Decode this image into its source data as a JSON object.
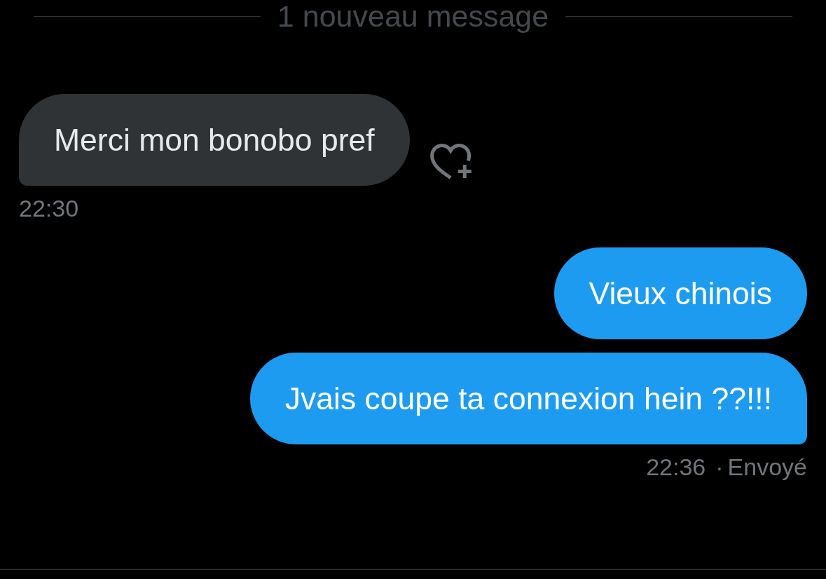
{
  "divider": {
    "label": "1 nouveau message"
  },
  "conversation": [
    {
      "kind": "received",
      "bubbles": [
        {
          "text": "Merci mon bonobo pref"
        }
      ],
      "time": "22:30"
    },
    {
      "kind": "sent",
      "bubbles": [
        {
          "text": "Vieux chinois"
        },
        {
          "text": "Jvais coupe ta connexion hein ??!!!"
        }
      ],
      "time": "22:36",
      "separator": "·",
      "status": "Envoyé"
    }
  ]
}
